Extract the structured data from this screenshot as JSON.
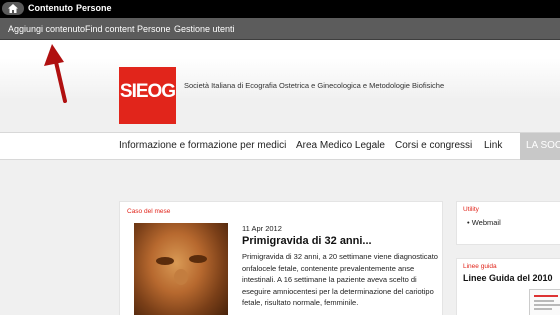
{
  "toolbar": {
    "items": [
      "Contenuto",
      "Persone"
    ]
  },
  "shortcuts": {
    "items": [
      "Aggiungi contenuto",
      "Find content",
      "Persone",
      "Gestione utenti"
    ]
  },
  "header": {
    "logo_text": "SIEOG",
    "site_name": "Società Italiana di Ecografia Ostetrica e Ginecologica e Metodologie Biofisiche"
  },
  "nav": {
    "items": [
      "Informazione e formazione per medici",
      "Area Medico Legale",
      "Corsi e congressi",
      "Link",
      "LA SOCI"
    ]
  },
  "main_box": {
    "label": "Caso del mese",
    "date": "11 Apr 2012",
    "title": "Primigravida di 32 anni...",
    "teaser": "Primigravida di 32 anni, a 20 settimane viene diagnosticato onfalocele fetale, contenente prevalentemente anse intestinali. A 16 settimane la paziente aveva scelto di eseguire amniocentesi per la determinazione del cariotipo fetale, risultato normale, femminile."
  },
  "utility_box": {
    "label": "Utility",
    "link": "Webmail"
  },
  "guide_box": {
    "label": "Linee guida",
    "title": "Linee Guida del 2010"
  },
  "colors": {
    "brand_red": "#e1251b",
    "toolbar": "#000000",
    "shortcut_bar": "#5c5c5c",
    "annotation_arrow": "#b01010"
  },
  "icons": {
    "home": "home-icon",
    "annotation": "red-arrow-icon",
    "bullet": "bullet-icon"
  }
}
